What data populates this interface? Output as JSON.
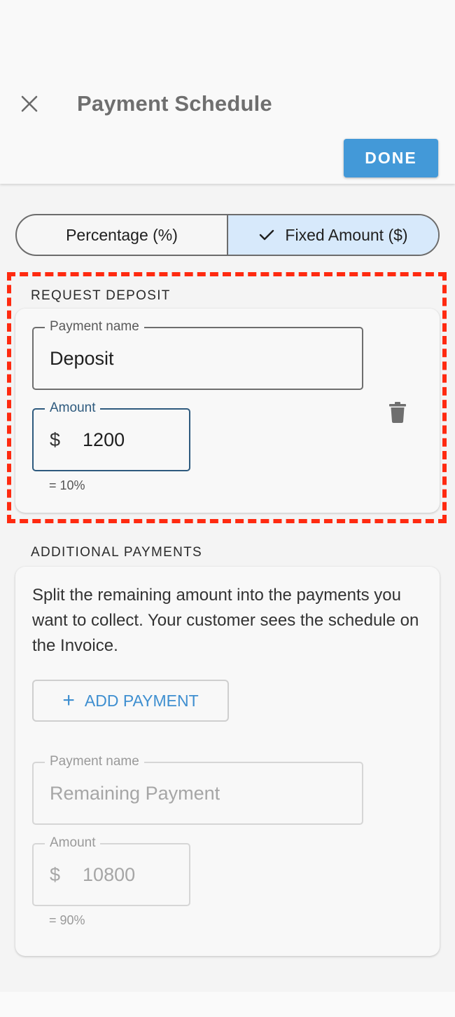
{
  "header": {
    "title": "Payment Schedule",
    "close_icon": "close-icon",
    "done_label": "DONE"
  },
  "mode_toggle": {
    "options": [
      {
        "label": "Percentage (%)",
        "selected": false
      },
      {
        "label": "Fixed Amount ($)",
        "selected": true
      }
    ]
  },
  "deposit": {
    "section_title": "REQUEST DEPOSIT",
    "payment_name_label": "Payment name",
    "payment_name_value": "Deposit",
    "amount_label": "Amount",
    "currency_prefix": "$",
    "amount_value": "1200",
    "percent_helper": "= 10%",
    "delete_icon": "trash-icon"
  },
  "additional": {
    "section_title": "ADDITIONAL PAYMENTS",
    "description": "Split the remaining amount into the payments you want to collect. Your customer sees the schedule on the Invoice.",
    "add_button_label": "ADD PAYMENT",
    "remaining": {
      "payment_name_label": "Payment name",
      "payment_name_value": "Remaining Payment",
      "amount_label": "Amount",
      "currency_prefix": "$",
      "amount_value": "10800",
      "percent_helper": "= 90%"
    }
  },
  "colors": {
    "primary": "#4399d8",
    "selected_segment": "#d7e9fb",
    "highlight_outline": "#ff2a10",
    "focused_field": "#2e5a7e"
  }
}
